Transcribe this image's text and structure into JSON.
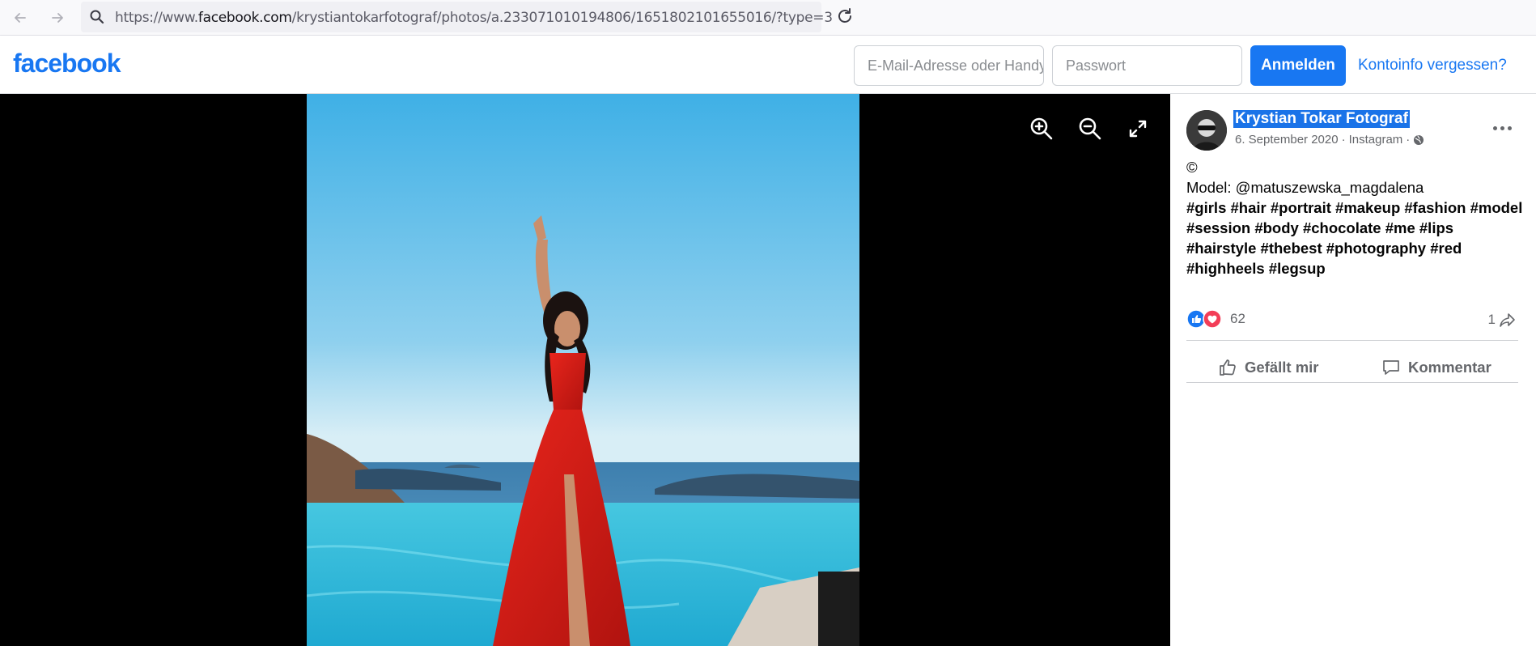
{
  "browser": {
    "url_prefix": "https://www.",
    "url_host": "facebook.com",
    "url_path": "/krystiantokarfotograf/photos/a.233071010194806/1651802101655016/?type=3"
  },
  "header": {
    "logo": "facebook",
    "email_placeholder": "E-Mail-Adresse oder Handynummer",
    "password_placeholder": "Passwort",
    "login_label": "Anmelden",
    "forgot_label": "Kontoinfo vergessen?"
  },
  "post": {
    "author": "Krystian Tokar Fotograf",
    "date": "6. September 2020",
    "source": "Instagram",
    "caption_symbol": "©",
    "caption_model": "Model: @matuszewska_magdalena",
    "caption_tags": "#girls #hair #portrait #makeup #fashion #model #session #body #chocolate #me #lips #hairstyle #thebest #photography #red #highheels #legsup",
    "reaction_count": "62",
    "share_count": "1",
    "like_label": "Gefällt mir",
    "comment_label": "Kommentar"
  },
  "colors": {
    "brand": "#1877f2",
    "love": "#f33e58"
  }
}
